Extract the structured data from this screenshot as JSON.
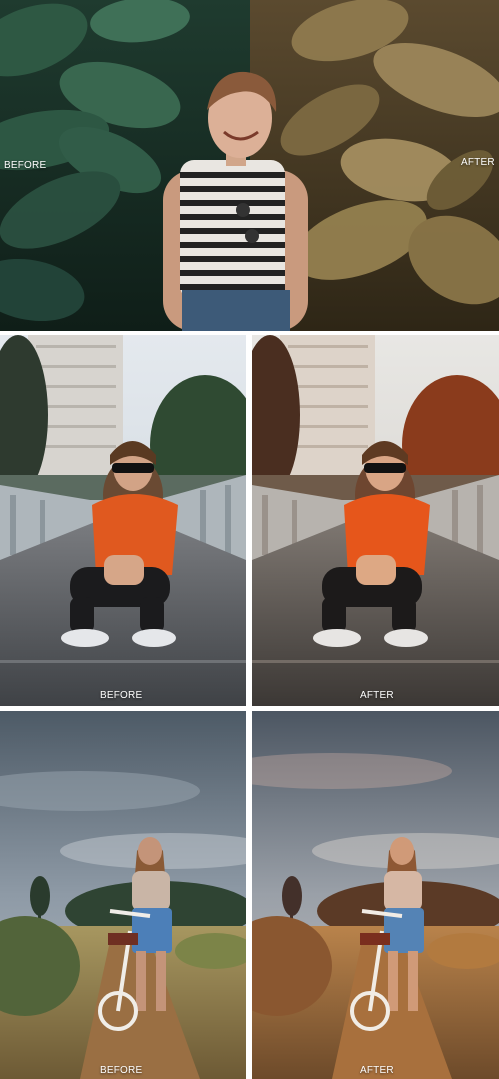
{
  "collage": {
    "panel_1": {
      "before_label": "BEFORE",
      "after_label": "AFTER"
    },
    "panel_2": {
      "before_label": "BEFORE",
      "after_label": "AFTER"
    },
    "panel_3": {
      "before_label": "BEFORE",
      "after_label": "AFTER"
    }
  }
}
